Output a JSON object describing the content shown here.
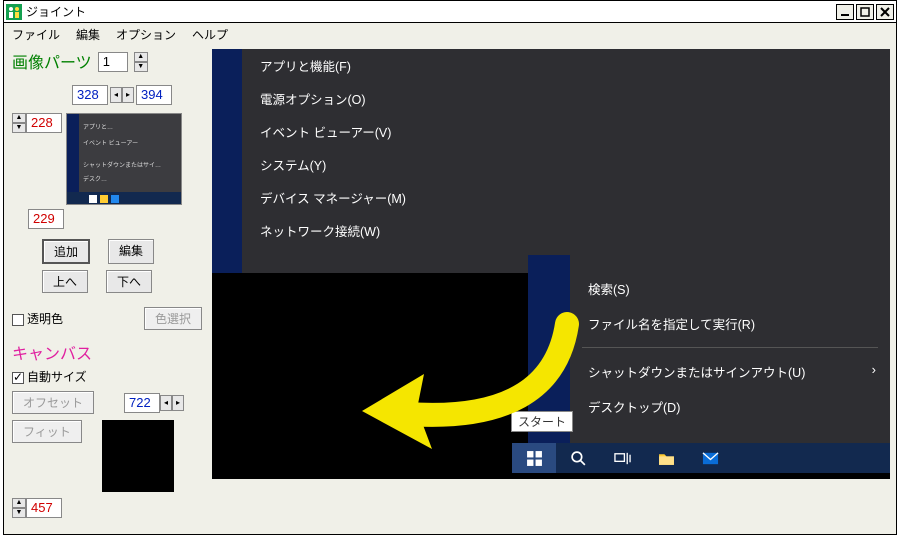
{
  "window": {
    "title": "ジョイント"
  },
  "menubar": [
    "ファイル",
    "編集",
    "オプション",
    "ヘルプ"
  ],
  "panel": {
    "image_parts": "画像パーツ",
    "parts_index": "1",
    "x": "328",
    "w": "394",
    "y": "228",
    "h": "229",
    "add": "追加",
    "edit": "編集",
    "up": "上へ",
    "down": "下へ",
    "transparent": "透明色",
    "pickcolor": "色選択",
    "canvas": "キャンバス",
    "autosize": "自動サイズ",
    "offset": "オフセット",
    "canvas_w": "722",
    "fit": "フィット",
    "canvas_h": "457"
  },
  "winx_left": [
    "アプリと機能(F)",
    "電源オプション(O)",
    "イベント ビューアー(V)",
    "システム(Y)",
    "デバイス マネージャー(M)",
    "ネットワーク接続(W)"
  ],
  "winx_right": {
    "search": "検索(S)",
    "run": "ファイル名を指定して実行(R)",
    "shutdown": "シャットダウンまたはサインアウト(U)",
    "desktop": "デスクトップ(D)"
  },
  "tooltip": "スタート",
  "thumb_lines": [
    "アプリと…",
    "イベント ビューアー",
    "シャットダウンまたはサイ…",
    "デスク…"
  ]
}
